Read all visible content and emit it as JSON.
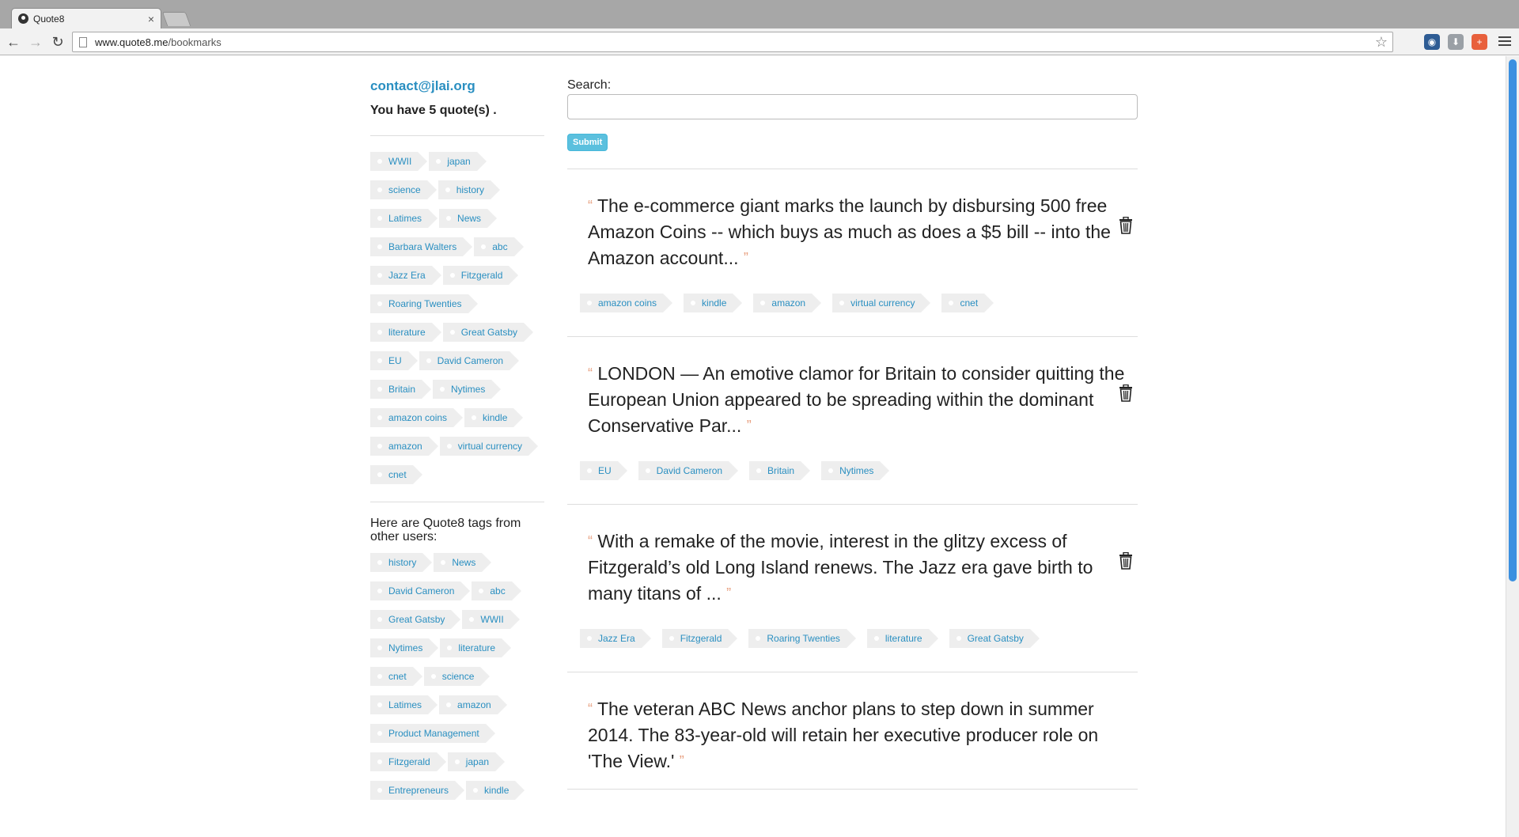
{
  "browser": {
    "tab_title": "Quote8",
    "tab_close": "×",
    "url_host": "www.quote8.me",
    "url_path": "/bookmarks",
    "back_glyph": "←",
    "forward_glyph": "→",
    "reload_glyph": "↻",
    "star_glyph": "☆",
    "ext_icons": [
      {
        "name": "record-extension-icon",
        "color": "#2e5c94",
        "glyph": "◉"
      },
      {
        "name": "download-extension-icon",
        "color": "#9aa0a6",
        "glyph": "⬇"
      },
      {
        "name": "plus-extension-icon",
        "color": "#e8603c",
        "glyph": "+"
      }
    ]
  },
  "sidebar": {
    "email": "contact@jlai.org",
    "quote_count": "You have 5 quote(s) .",
    "my_tags": [
      "WWII",
      "japan",
      "science",
      "history",
      "Latimes",
      "News",
      "Barbara Walters",
      "abc",
      "Jazz Era",
      "Fitzgerald",
      "Roaring Twenties",
      "literature",
      "Great Gatsby",
      "EU",
      "David Cameron",
      "Britain",
      "Nytimes",
      "amazon coins",
      "kindle",
      "amazon",
      "virtual currency",
      "cnet"
    ],
    "other_heading": "Here are Quote8 tags from other users:",
    "other_tags": [
      "history",
      "News",
      "David Cameron",
      "abc",
      "Great Gatsby",
      "WWII",
      "Nytimes",
      "literature",
      "cnet",
      "science",
      "Latimes",
      "amazon",
      "Product Management",
      "Fitzgerald",
      "japan",
      "Entrepreneurs",
      "kindle"
    ]
  },
  "search": {
    "label": "Search:",
    "placeholder": "",
    "submit_label": "Submit"
  },
  "quotes": [
    {
      "text": "The e-commerce giant marks the launch by disbursing 500 free Amazon Coins -- which buys as much as does a $5 bill -- into the Amazon account...",
      "tags": [
        "amazon coins",
        "kindle",
        "amazon",
        "virtual currency",
        "cnet"
      ]
    },
    {
      "text": "LONDON — An emotive clamor for Britain to consider quitting the European Union appeared to be spreading within the dominant Conservative Par...",
      "tags": [
        "EU",
        "David Cameron",
        "Britain",
        "Nytimes"
      ]
    },
    {
      "text": "With a remake of the movie, interest in the glitzy excess of Fitzgerald’s old Long Island renews. The Jazz era gave birth to many titans of ...",
      "tags": [
        "Jazz Era",
        "Fitzgerald",
        "Roaring Twenties",
        "literature",
        "Great Gatsby"
      ]
    },
    {
      "text": "The veteran ABC News anchor plans to step down in summer 2014. The 83-year-old will retain her executive producer role on 'The View.'",
      "tags": []
    }
  ],
  "quote_open": "“",
  "quote_close": "”",
  "colors": {
    "link": "#2a8fc1",
    "tag_bg": "#eeeeee",
    "submit_bg": "#5bc0de",
    "quote_mark": "#e8a080"
  }
}
